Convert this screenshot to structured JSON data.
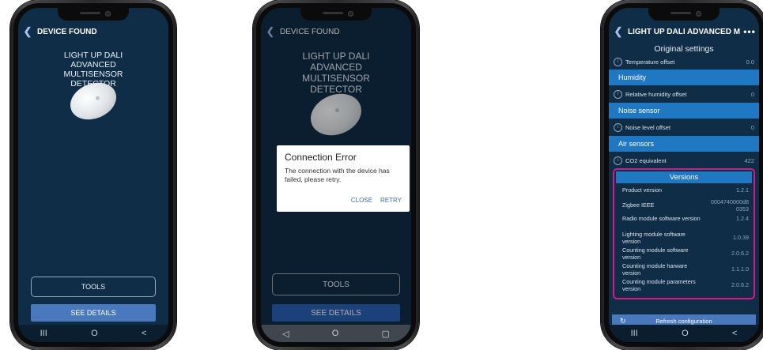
{
  "phone1": {
    "header_title": "DEVICE FOUND",
    "device_name": "LIGHT UP DALI ADVANCED MULTISENSOR DETECTOR",
    "tools_button": "TOOLS",
    "details_button": "SEE DETAILS",
    "nav": {
      "recents": "III",
      "home": "O",
      "back": "<"
    }
  },
  "phone2": {
    "header_title": "DEVICE FOUND",
    "device_name": "LIGHT UP DALI ADVANCED MULTISENSOR DETECTOR",
    "dialog": {
      "title": "Connection Error",
      "message": "The connection with the device has failed, please retry.",
      "close": "CLOSE",
      "retry": "RETRY"
    },
    "tools_button": "TOOLS",
    "details_button": "SEE DETAILS",
    "nav": {
      "back": "◁",
      "home": "O",
      "recents": "▢"
    }
  },
  "phone3": {
    "header_title": "LIGHT UP DALI ADVANCED M...",
    "menu": "•••",
    "original_settings": "Original settings",
    "temperature_offset": {
      "label": "Temperature offset",
      "value": "0.0"
    },
    "humidity_band": "Humidity",
    "humidity_offset": {
      "label": "Relative humidity offset",
      "value": "0"
    },
    "noise_band": "Noise sensor",
    "noise_offset": {
      "label": "Noise level offset",
      "value": "0"
    },
    "air_band": "Air sensors",
    "co2": {
      "label": "CO2 equivalent",
      "value": "422"
    },
    "versions_title": "Versions",
    "versions": [
      {
        "label": "Product version",
        "value": "1.2.1"
      },
      {
        "label": "Zigbee IEEE",
        "value": "0004740000d8 0353"
      },
      {
        "label": "Radio module software version",
        "value": "1.2.4"
      },
      {
        "label": "Lighting module software version",
        "value": "1.0.39"
      },
      {
        "label": "Counting module software version",
        "value": "2.0.6.2"
      },
      {
        "label": "Counting module harware version",
        "value": "1.1.1.0"
      },
      {
        "label": "Counting module parameters version",
        "value": "2.0.6.2"
      }
    ],
    "refresh": "Refresh configuration",
    "nav": {
      "recents": "III",
      "home": "O",
      "back": "<"
    }
  },
  "colors": {
    "screen_bg": "#0f2d47",
    "band": "#2077c2",
    "button": "#4a78bd",
    "highlight": "#d21c8a"
  }
}
